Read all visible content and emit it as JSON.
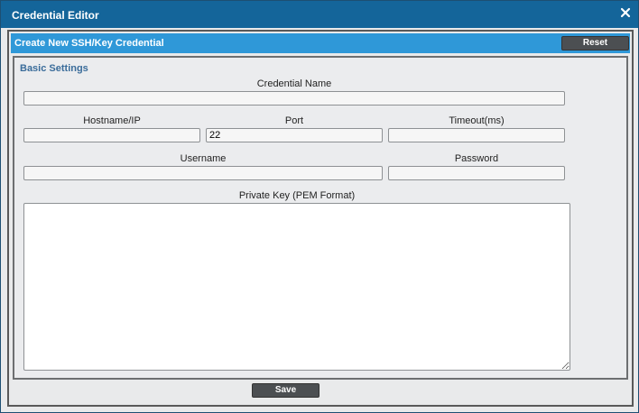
{
  "window": {
    "title": "Credential Editor",
    "close_icon": "close-icon"
  },
  "panel": {
    "title": "Create New SSH/Key Credential",
    "reset_label": "Reset"
  },
  "basic_settings": {
    "title": "Basic Settings",
    "credential_name": {
      "label": "Credential Name",
      "value": ""
    },
    "hostname": {
      "label": "Hostname/IP",
      "value": ""
    },
    "port": {
      "label": "Port",
      "value": "22"
    },
    "timeout": {
      "label": "Timeout(ms)",
      "value": ""
    },
    "username": {
      "label": "Username",
      "value": ""
    },
    "password": {
      "label": "Password",
      "value": ""
    },
    "private_key": {
      "label": "Private Key (PEM Format)",
      "value": ""
    }
  },
  "footer": {
    "save_label": "Save"
  }
}
